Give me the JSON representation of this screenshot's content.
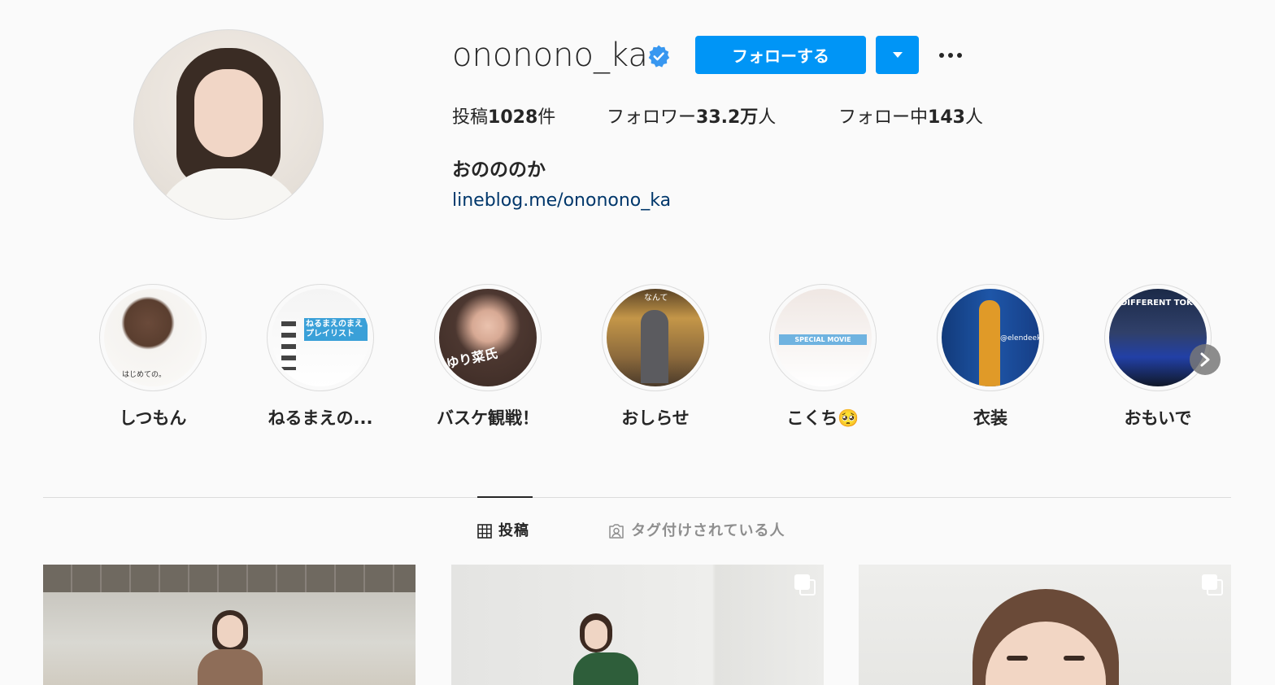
{
  "profile": {
    "username": "ononono_ka",
    "follow_label": "フォローする",
    "stats": {
      "posts_prefix": "投稿",
      "posts_count": "1028",
      "posts_suffix": "件",
      "followers_prefix": "フォロワー",
      "followers_count": "33.2万",
      "followers_suffix": "人",
      "following_prefix": "フォロー中",
      "following_count": "143",
      "following_suffix": "人"
    },
    "full_name": "おのののか",
    "bio_link": "lineblog.me/ononono_ka"
  },
  "highlights": [
    {
      "label": "しつもん",
      "img_text": "はじめての。"
    },
    {
      "label": "ねるまえの...",
      "img_text": "ねるまえのまえ プレイリスト"
    },
    {
      "label": "バスケ観戦！",
      "img_text": "ゆり菜氏"
    },
    {
      "label": "おしらせ",
      "img_text": "なんて"
    },
    {
      "label": "こくち🥺",
      "img_text": "SPECIAL MOVIE"
    },
    {
      "label": "衣装",
      "img_text": "@elendeek"
    },
    {
      "label": "おもいで",
      "img_text": "DIFFERENT TOKYO"
    }
  ],
  "tabs": {
    "posts": "投稿",
    "tagged": "タグ付けされている人"
  },
  "colors": {
    "accent": "#0095f6",
    "link": "#00376b",
    "muted": "#8e8e8e"
  }
}
